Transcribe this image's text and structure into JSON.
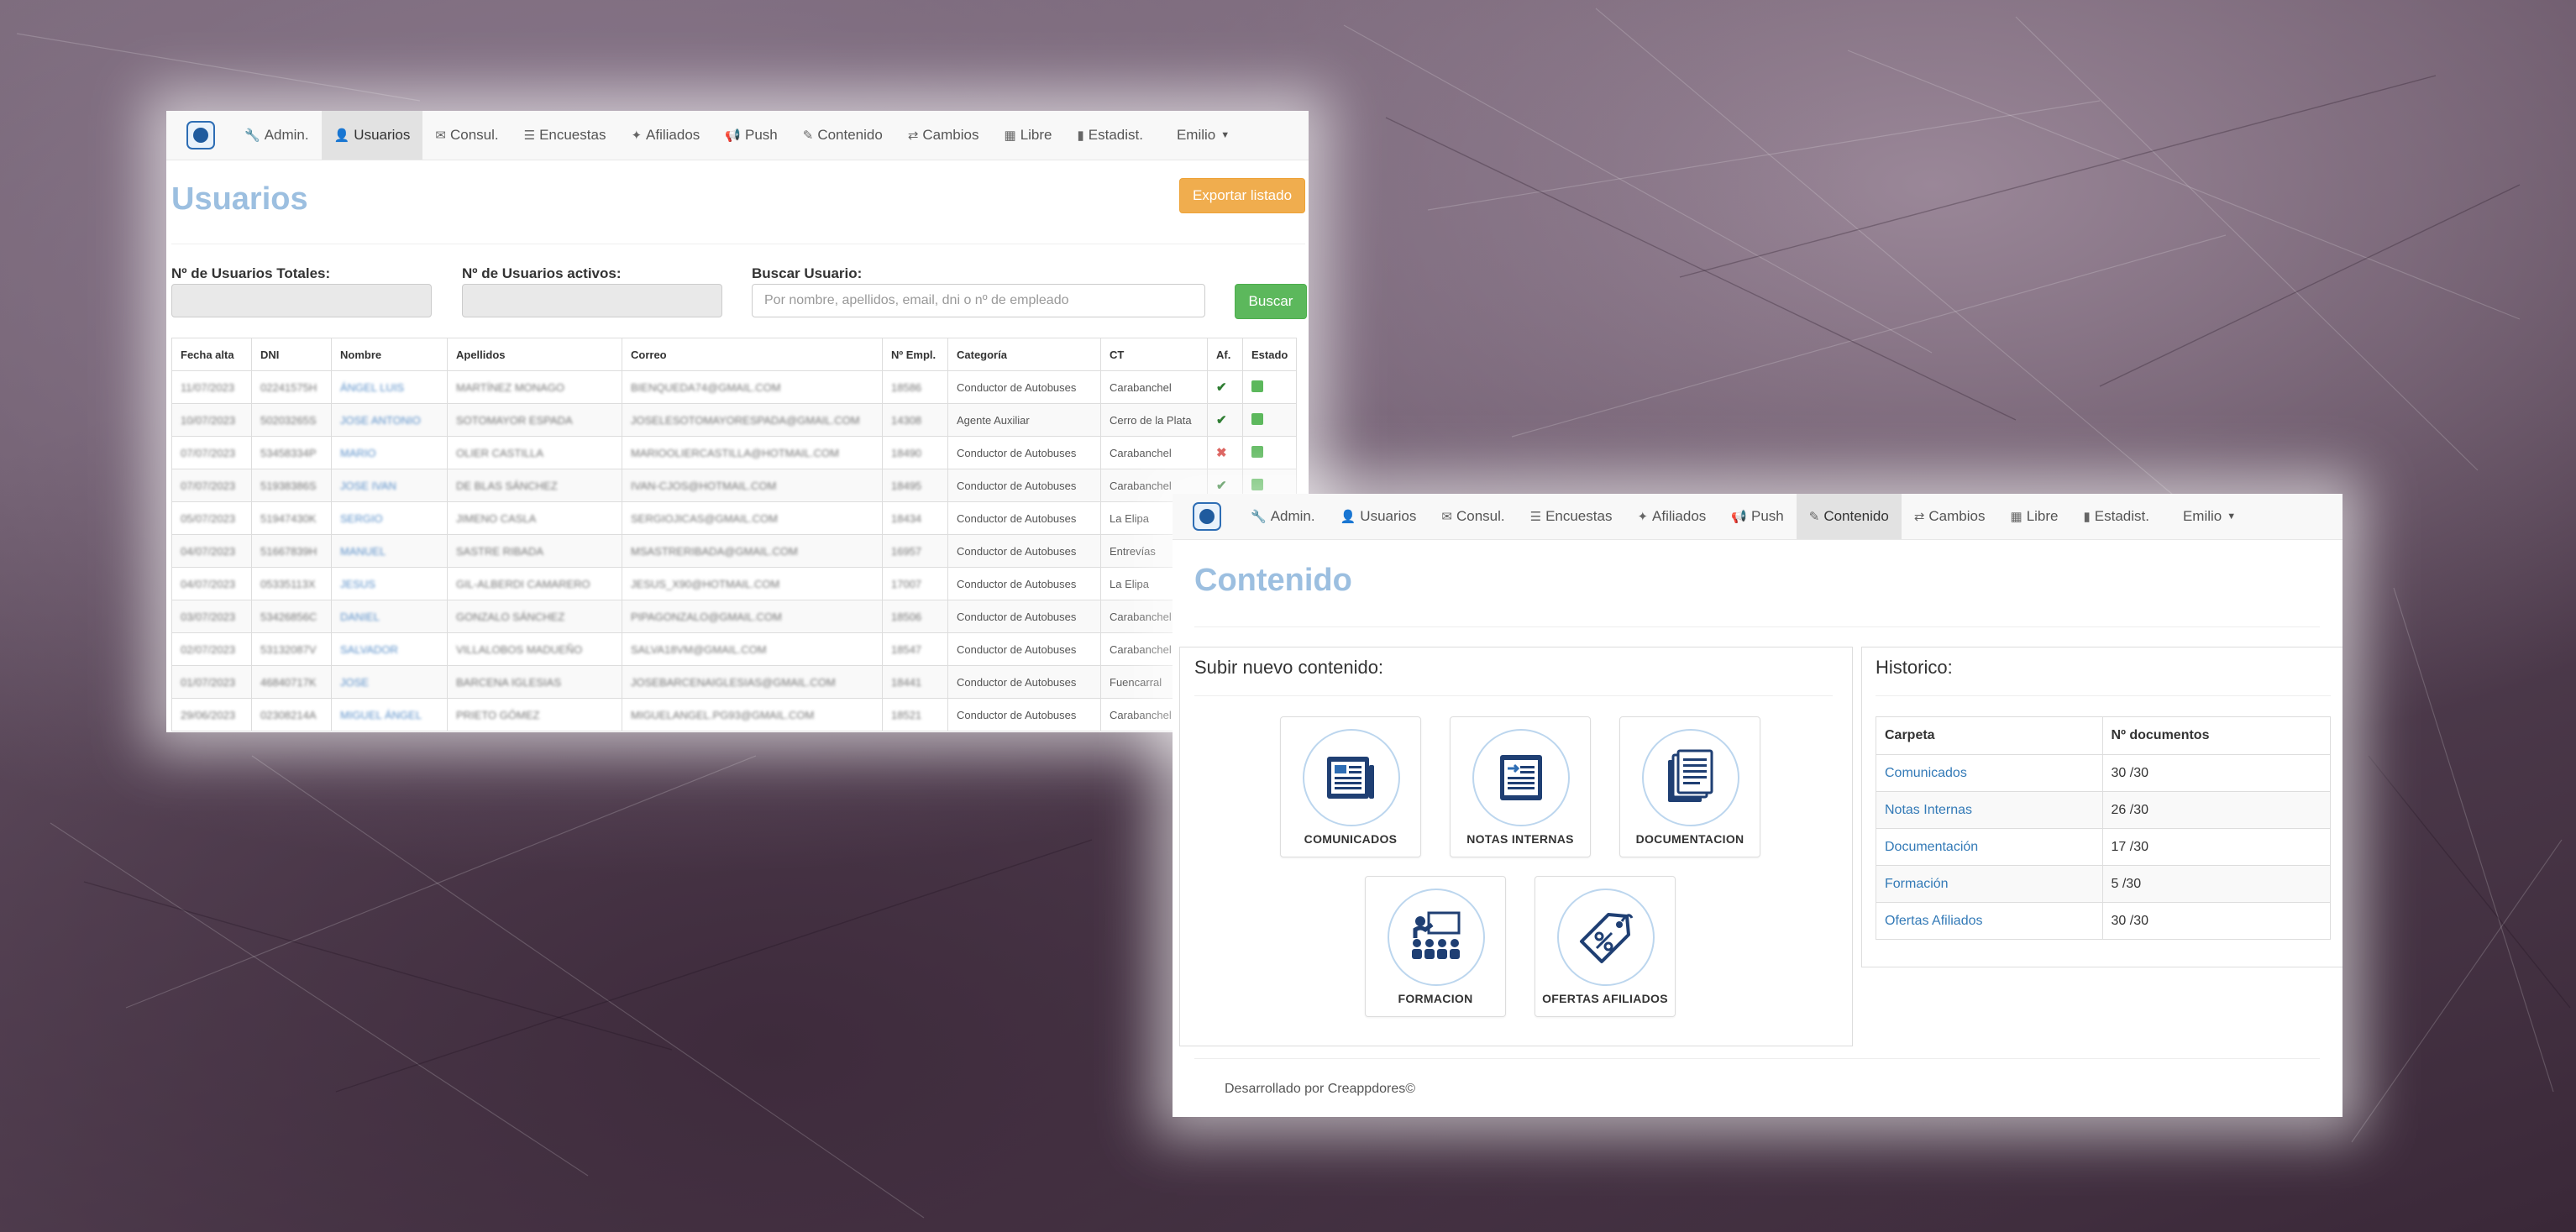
{
  "nav1": {
    "items": [
      {
        "label": "Admin.",
        "icon": "wrench-icon",
        "glyph": "🔧"
      },
      {
        "label": "Usuarios",
        "icon": "user-icon",
        "glyph": "👤"
      },
      {
        "label": "Consul.",
        "icon": "envelope-icon",
        "glyph": "✉"
      },
      {
        "label": "Encuestas",
        "icon": "list-icon",
        "glyph": "☰"
      },
      {
        "label": "Afiliados",
        "icon": "bullhorn-icon",
        "glyph": "✦"
      },
      {
        "label": "Push",
        "icon": "megaphone-icon",
        "glyph": "📢"
      },
      {
        "label": "Contenido",
        "icon": "document-icon",
        "glyph": "✎"
      },
      {
        "label": "Cambios",
        "icon": "retweet-icon",
        "glyph": "⇄"
      },
      {
        "label": "Libre",
        "icon": "calendar-icon",
        "glyph": "▦"
      },
      {
        "label": "Estadist.",
        "icon": "signal-icon",
        "glyph": "▮"
      }
    ],
    "user": "Emilio"
  },
  "usuarios": {
    "title": "Usuarios",
    "export_label": "Exportar listado",
    "total_label": "Nº de Usuarios Totales:",
    "active_label": "Nº de Usuarios activos:",
    "search_label": "Buscar Usuario:",
    "search_placeholder": "Por nombre, apellidos, email, dni o nº de empleado",
    "search_button": "Buscar",
    "columns": [
      "Fecha alta",
      "DNI",
      "Nombre",
      "Apellidos",
      "Correo",
      "Nº Empl.",
      "Categoría",
      "CT",
      "Af.",
      "Estado"
    ],
    "rows": [
      {
        "fecha": "11/07/2023",
        "dni": "02241575H",
        "nombre": "ÁNGEL LUIS",
        "apellidos": "MARTÍNEZ MONAGO",
        "correo": "BIENQUEDA74@GMAIL.COM",
        "empl": "18586",
        "cat": "Conductor de Autobuses",
        "ct": "Carabanchel",
        "af": "yes"
      },
      {
        "fecha": "10/07/2023",
        "dni": "50203265S",
        "nombre": "JOSE ANTONIO",
        "apellidos": "SOTOMAYOR ESPADA",
        "correo": "JOSELESOTOMAYORESPADA@GMAIL.COM",
        "empl": "14308",
        "cat": "Agente Auxiliar",
        "ct": "Cerro de la Plata",
        "af": "yes"
      },
      {
        "fecha": "07/07/2023",
        "dni": "53458334P",
        "nombre": "MARIO",
        "apellidos": "OLIER CASTILLA",
        "correo": "MARIOOLIERCASTILLA@HOTMAIL.COM",
        "empl": "18490",
        "cat": "Conductor de Autobuses",
        "ct": "Carabanchel",
        "af": "no"
      },
      {
        "fecha": "07/07/2023",
        "dni": "51938386S",
        "nombre": "JOSE IVAN",
        "apellidos": "DE BLAS SÁNCHEZ",
        "correo": "IVAN-CJOS@HOTMAIL.COM",
        "empl": "18495",
        "cat": "Conductor de Autobuses",
        "ct": "Carabanchel",
        "af": "yes"
      },
      {
        "fecha": "05/07/2023",
        "dni": "51947430K",
        "nombre": "SERGIO",
        "apellidos": "JIMENO CASLA",
        "correo": "SERGIOJICAS@GMAIL.COM",
        "empl": "18434",
        "cat": "Conductor de Autobuses",
        "ct": "La Elipa",
        "af": ""
      },
      {
        "fecha": "04/07/2023",
        "dni": "51667839H",
        "nombre": "MANUEL",
        "apellidos": "SASTRE RIBADA",
        "correo": "MSASTRERIBADA@GMAIL.COM",
        "empl": "16957",
        "cat": "Conductor de Autobuses",
        "ct": "Entrevías",
        "af": ""
      },
      {
        "fecha": "04/07/2023",
        "dni": "05335113X",
        "nombre": "JESUS",
        "apellidos": "GIL-ALBERDI CAMARERO",
        "correo": "JESUS_X90@HOTMAIL.COM",
        "empl": "17007",
        "cat": "Conductor de Autobuses",
        "ct": "La Elipa",
        "af": ""
      },
      {
        "fecha": "03/07/2023",
        "dni": "53426856C",
        "nombre": "DANIEL",
        "apellidos": "GONZALO SÁNCHEZ",
        "correo": "PIPAGONZALO@GMAIL.COM",
        "empl": "18506",
        "cat": "Conductor de Autobuses",
        "ct": "Carabanchel",
        "af": ""
      },
      {
        "fecha": "02/07/2023",
        "dni": "53132087V",
        "nombre": "SALVADOR",
        "apellidos": "VILLALOBOS MADUEÑO",
        "correo": "SALVA18VM@GMAIL.COM",
        "empl": "18547",
        "cat": "Conductor de Autobuses",
        "ct": "Carabanchel",
        "af": ""
      },
      {
        "fecha": "01/07/2023",
        "dni": "46840717K",
        "nombre": "JOSE",
        "apellidos": "BARCENA IGLESIAS",
        "correo": "JOSEBARCENAIGLESIAS@GMAIL.COM",
        "empl": "18441",
        "cat": "Conductor de Autobuses",
        "ct": "Fuencarral",
        "af": ""
      },
      {
        "fecha": "29/06/2023",
        "dni": "02308214A",
        "nombre": "MIGUEL ÁNGEL",
        "apellidos": "PRIETO GÓMEZ",
        "correo": "MIGUELANGEL.PG93@GMAIL.COM",
        "empl": "18521",
        "cat": "Conductor de Autobuses",
        "ct": "Carabanchel",
        "af": ""
      }
    ]
  },
  "nav2": {
    "items": [
      {
        "label": "Admin.",
        "icon": "wrench-icon",
        "glyph": "🔧"
      },
      {
        "label": "Usuarios",
        "icon": "user-icon",
        "glyph": "👤"
      },
      {
        "label": "Consul.",
        "icon": "envelope-icon",
        "glyph": "✉"
      },
      {
        "label": "Encuestas",
        "icon": "list-icon",
        "glyph": "☰"
      },
      {
        "label": "Afiliados",
        "icon": "bullhorn-icon",
        "glyph": "✦"
      },
      {
        "label": "Push",
        "icon": "megaphone-icon",
        "glyph": "📢"
      },
      {
        "label": "Contenido",
        "icon": "document-icon",
        "glyph": "✎"
      },
      {
        "label": "Cambios",
        "icon": "retweet-icon",
        "glyph": "⇄"
      },
      {
        "label": "Libre",
        "icon": "calendar-icon",
        "glyph": "▦"
      },
      {
        "label": "Estadist.",
        "icon": "signal-icon",
        "glyph": "▮"
      }
    ],
    "user": "Emilio"
  },
  "contenido": {
    "title": "Contenido",
    "upload_title": "Subir nuevo contenido:",
    "tiles": [
      {
        "label": "COMUNICADOS",
        "icon": "newspaper-icon"
      },
      {
        "label": "NOTAS INTERNAS",
        "icon": "internal-note-icon"
      },
      {
        "label": "DOCUMENTACION",
        "icon": "documents-icon"
      },
      {
        "label": "FORMACION",
        "icon": "training-icon"
      },
      {
        "label": "OFERTAS AFILIADOS",
        "icon": "discount-tag-icon"
      }
    ],
    "historico_title": "Historico:",
    "columns": [
      "Carpeta",
      "Nº documentos"
    ],
    "rows": [
      {
        "carpeta": "Comunicados",
        "docs": "30 /30"
      },
      {
        "carpeta": "Notas Internas",
        "docs": "26 /30"
      },
      {
        "carpeta": "Documentación",
        "docs": "17 /30"
      },
      {
        "carpeta": "Formación",
        "docs": "5 /30"
      },
      {
        "carpeta": "Ofertas Afiliados",
        "docs": "30 /30"
      }
    ],
    "footer": "Desarrollado por Creappdores©"
  }
}
